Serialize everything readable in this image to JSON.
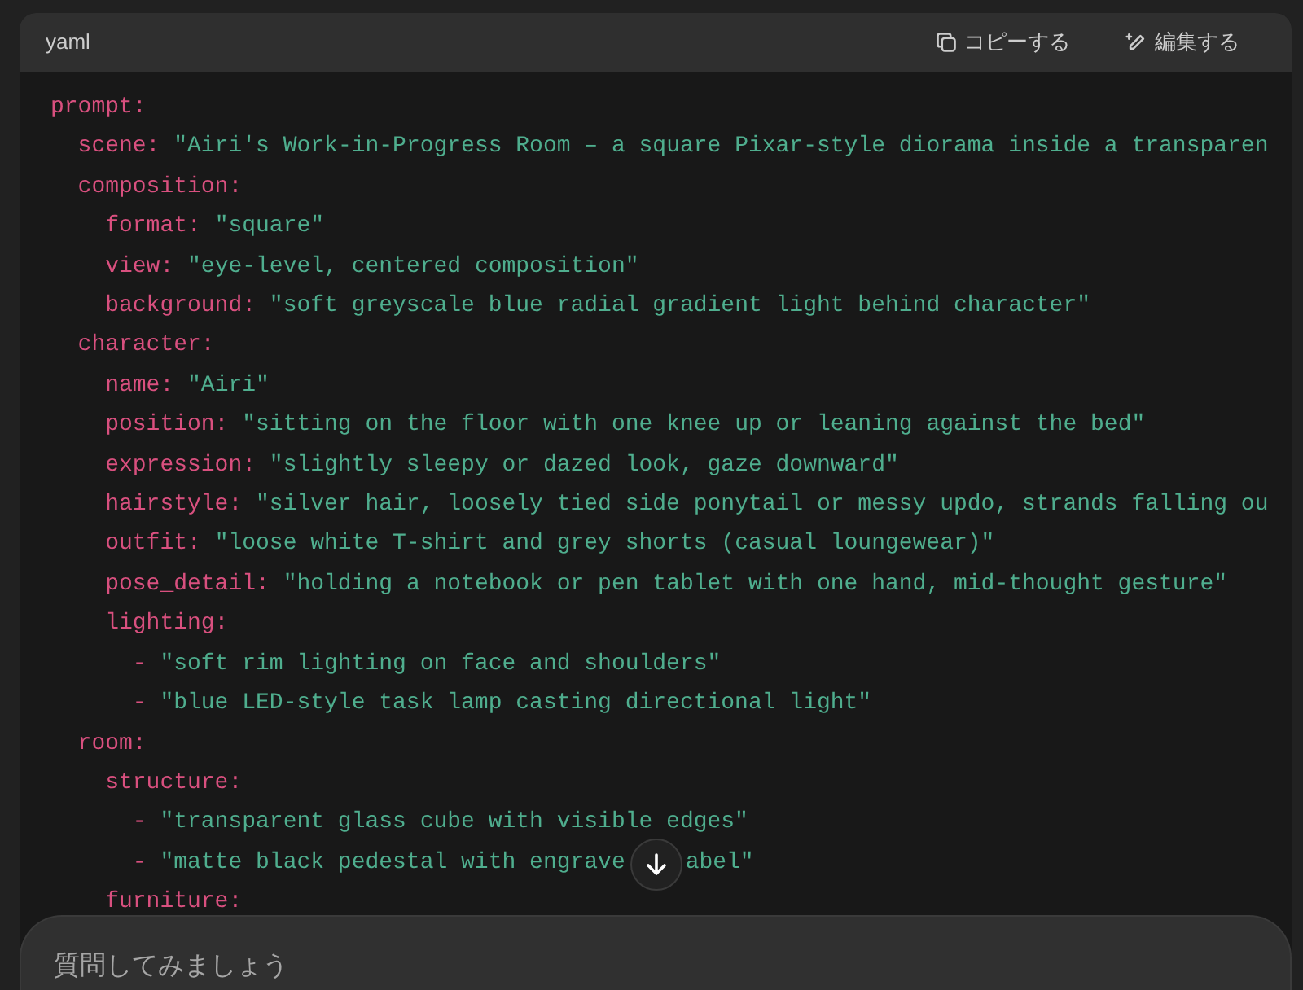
{
  "code_block": {
    "language": "yaml",
    "actions": [
      {
        "kind": "copy",
        "label": "コピーする"
      },
      {
        "kind": "edit",
        "label": "編集する"
      }
    ],
    "lines": [
      {
        "kind": "key",
        "key": "prompt:",
        "children": [
          {
            "kind": "key",
            "key": "scene:",
            "value": "\"Airi's Work-in-Progress Room – a square Pixar-style diorama inside a transparen"
          },
          {
            "kind": "key",
            "key": "composition:",
            "children": [
              {
                "kind": "key",
                "key": "format:",
                "value": "\"square\""
              },
              {
                "kind": "key",
                "key": "view:",
                "value": "\"eye-level, centered composition\""
              },
              {
                "kind": "key",
                "key": "background:",
                "value": "\"soft greyscale blue radial gradient light behind character\""
              }
            ]
          },
          {
            "kind": "key",
            "key": "character:",
            "children": [
              {
                "kind": "key",
                "key": "name:",
                "value": "\"Airi\""
              },
              {
                "kind": "key",
                "key": "position:",
                "value": "\"sitting on the floor with one knee up or leaning against the bed\""
              },
              {
                "kind": "key",
                "key": "expression:",
                "value": "\"slightly sleepy or dazed look, gaze downward\""
              },
              {
                "kind": "key",
                "key": "hairstyle:",
                "value": "\"silver hair, loosely tied side ponytail or messy updo, strands falling ou"
              },
              {
                "kind": "key",
                "key": "outfit:",
                "value": "\"loose white T-shirt and grey shorts (casual loungewear)\""
              },
              {
                "kind": "key",
                "key": "pose_detail:",
                "value": "\"holding a notebook or pen tablet with one hand, mid-thought gesture\""
              },
              {
                "kind": "key",
                "key": "lighting:",
                "children": [
                  {
                    "kind": "item",
                    "marker": "-",
                    "value": "\"soft rim lighting on face and shoulders\""
                  },
                  {
                    "kind": "item",
                    "marker": "-",
                    "value": "\"blue LED-style task lamp casting directional light\""
                  }
                ]
              }
            ]
          },
          {
            "kind": "key",
            "key": "room:",
            "children": [
              {
                "kind": "key",
                "key": "structure:",
                "children": [
                  {
                    "kind": "item",
                    "marker": "-",
                    "value": "\"transparent glass cube with visible edges\""
                  },
                  {
                    "kind": "item",
                    "marker": "-",
                    "value": "\"matte black pedestal with engrave",
                    "value_after": "abel\""
                  }
                ]
              },
              {
                "kind": "key",
                "key": "furniture:"
              }
            ]
          }
        ]
      }
    ]
  },
  "composer": {
    "placeholder": "質問してみましょう"
  }
}
